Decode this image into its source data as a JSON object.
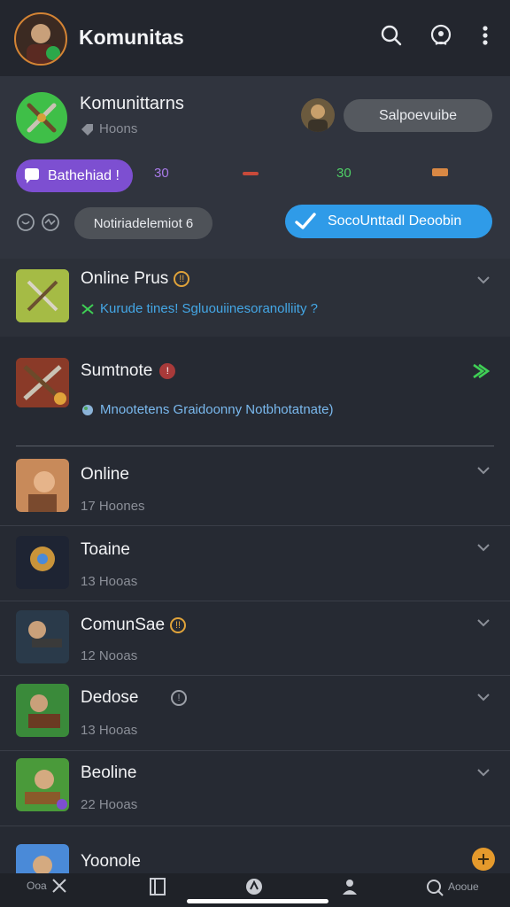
{
  "header": {
    "title": "Komunitas",
    "icons": [
      "search-icon",
      "chat-bubble-icon",
      "more-vert-icon"
    ]
  },
  "hero": {
    "community_name": "Komunittarns",
    "community_sub": "Hoons",
    "action_pill": "Salpoevuibe",
    "tag_pill": "Bathehiad !",
    "tag_values": [
      "30",
      "",
      "30",
      ""
    ],
    "notif_pill": "Notiriadelemiot 6",
    "cta_pill": "SocoUnttadl Deoobin"
  },
  "rows": [
    {
      "title": "Online Prus",
      "badge": "!!",
      "sub": "Kurude tines! Sgluouiinesoranolliity ?",
      "sub_color": "#44a7e6",
      "badge_color": "#e0a33a"
    },
    {
      "title": "Sumtnote",
      "badge": "!",
      "sub": "Mnootetens Graidoonny Notbhotatnate)",
      "sub_color": "#7ab9ee",
      "badge_color": "#d94848"
    },
    {
      "title": "Online",
      "badge": "",
      "sub": "17 Hoones",
      "sub_color": "#8b8f98",
      "badge_color": ""
    },
    {
      "title": "Toaine",
      "badge": "",
      "sub": "13 Hooas",
      "sub_color": "#8b8f98",
      "badge_color": ""
    },
    {
      "title": "ComunSae",
      "badge": "!!",
      "sub": "12 Nooas",
      "sub_color": "#8b8f98",
      "badge_color": "#e0a33a"
    },
    {
      "title": "Dedose",
      "badge": "!",
      "sub": "13 Hooas",
      "sub_color": "#8b8f98",
      "badge_color": "#9ca0a8"
    },
    {
      "title": "Beoline",
      "badge": "",
      "sub": "22 Hooas",
      "sub_color": "#8b8f98",
      "badge_color": ""
    },
    {
      "title": "Yoonole",
      "badge": "",
      "sub": "",
      "sub_color": "#8b8f98",
      "badge_color": ""
    }
  ],
  "bottom_nav": {
    "left_label": "Ooa",
    "right_label": "Aooue"
  },
  "colors": {
    "accent_blue": "#2f9be8",
    "accent_purple": "#7d4fd1",
    "accent_green": "#3fcf55"
  }
}
